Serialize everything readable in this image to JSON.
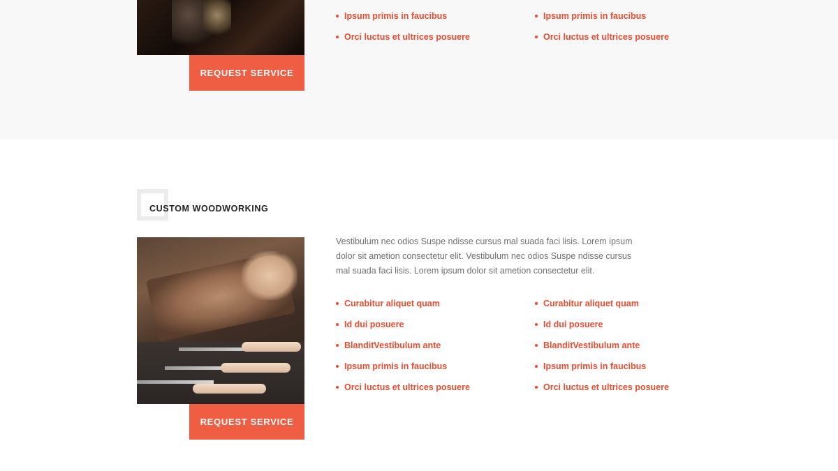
{
  "top_service": {
    "list_left": [
      "Ipsum primis in faucibus",
      "Orci luctus et ultrices posuere"
    ],
    "list_right": [
      "Ipsum primis in faucibus",
      "Orci luctus et ultrices posuere"
    ],
    "button_label": "REQUEST SERVICE"
  },
  "woodworking": {
    "title": "CUSTOM WOODWORKING",
    "description": "Vestibulum nec odios Suspe ndisse cursus mal suada faci lisis. Lorem ipsum dolor sit ametion consectetur elit. Vestibulum nec odios Suspe ndisse cursus mal suada faci lisis. Lorem ipsum dolor sit ametion consectetur elit.",
    "list_left": [
      "Curabitur aliquet quam",
      "Id dui posuere",
      "BlanditVestibulum ante",
      "Ipsum primis in faucibus",
      "Orci luctus et ultrices posuere"
    ],
    "list_right": [
      "Curabitur aliquet quam",
      "Id dui posuere",
      "BlanditVestibulum ante",
      "Ipsum primis in faucibus",
      "Orci luctus et ultrices posuere"
    ],
    "button_label": "REQUEST SERVICE"
  },
  "colors": {
    "accent": "#ef5d43",
    "bullet_text": "#ea4c2f",
    "top_section_bg": "#f8f8f8"
  }
}
